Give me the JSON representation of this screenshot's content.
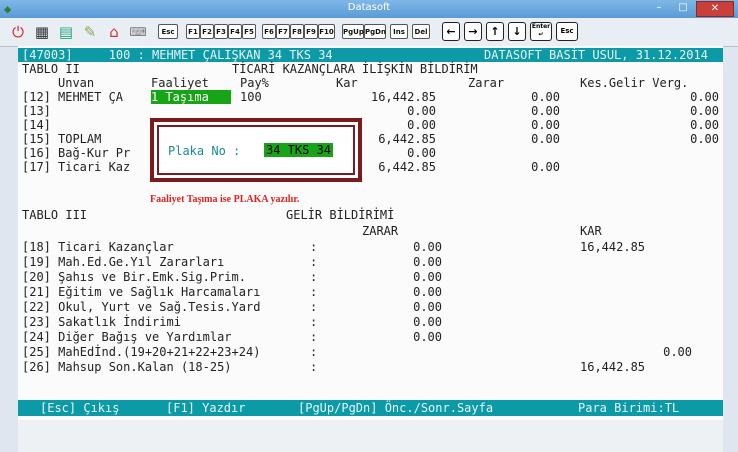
{
  "window": {
    "title": "Datasoft",
    "minimize": "–",
    "maximize": "□",
    "close": "✕"
  },
  "toolbar": {
    "keys": [
      "Esc",
      "F1",
      "F2",
      "F3",
      "F4",
      "F5",
      "F6",
      "F7",
      "F8",
      "F9",
      "F10",
      "PgUp",
      "PgDn",
      "Ins",
      "Del",
      "Enter",
      "Esc"
    ]
  },
  "header": {
    "left": "[47003]     100 : MEHMET ÇALIŞKAN 34 TKS 34",
    "right": "DATASOFT BASİT USUL, 31.12.2014"
  },
  "tablo2": {
    "name": "TABLO II",
    "title": "TİCARİ KAZANÇLARA İLİŞKİN BİLDİRİM",
    "cols": {
      "unvan": "Unvan",
      "faaliyet": "Faaliyet",
      "pay": "Pay%",
      "kar": "Kar",
      "zarar": "Zarar",
      "kes": "Kes.Gelir Verg."
    },
    "rows": [
      {
        "no": "[12]",
        "unvan": "MEHMET ÇA",
        "faaliyet": "1 Taşıma",
        "pay": "100",
        "kar": "16,442.85",
        "zarar": "0.00",
        "kes": "0.00"
      },
      {
        "no": "[13]",
        "unvan": "",
        "faaliyet": "",
        "pay": "",
        "kar": "0.00",
        "zarar": "0.00",
        "kes": "0.00"
      },
      {
        "no": "[14]",
        "unvan": "",
        "faaliyet": "",
        "pay": "",
        "kar": "0.00",
        "zarar": "0.00",
        "kes": "0.00"
      },
      {
        "no": "[15]",
        "unvan": "TOPLAM",
        "faaliyet": "",
        "pay": "",
        "kar": "6,442.85",
        "zarar": "0.00",
        "kes": "0.00"
      },
      {
        "no": "[16]",
        "unvan": "Bağ-Kur Pr",
        "faaliyet": "",
        "pay": "",
        "kar": "0.00",
        "zarar": "",
        "kes": ""
      },
      {
        "no": "[17]",
        "unvan": "Ticari Kaz",
        "faaliyet": "",
        "pay": "",
        "kar": "6,442.85",
        "zarar": "0.00",
        "kes": ""
      }
    ]
  },
  "dialog": {
    "label": "Plaka No :",
    "value": "34 TKS 34"
  },
  "hint": "Faaliyet Taşıma ise PLAKA yazılır.",
  "tablo3": {
    "name": "TABLO III",
    "title": "GELİR BİLDİRİMİ",
    "col_zarar": "ZARAR",
    "col_kar": "KAR",
    "rows": [
      {
        "text": "[18] Ticari Kazançlar",
        "colon": ":",
        "zarar": "0.00",
        "kar": "16,442.85"
      },
      {
        "text": "[19] Mah.Ed.Ge.Yıl Zararları",
        "colon": ":",
        "zarar": "0.00",
        "kar": ""
      },
      {
        "text": "[20] Şahıs ve Bir.Emk.Sig.Prim.",
        "colon": ":",
        "zarar": "0.00",
        "kar": ""
      },
      {
        "text": "[21] Eğitim ve Sağlık Harcamaları",
        "colon": ":",
        "zarar": "0.00",
        "kar": ""
      },
      {
        "text": "[22] Okul, Yurt ve Sağ.Tesis.Yard",
        "colon": ":",
        "zarar": "0.00",
        "kar": ""
      },
      {
        "text": "[23] Sakatlık İndirimi",
        "colon": ":",
        "zarar": "0.00",
        "kar": ""
      },
      {
        "text": "[24] Diğer Bağış ve Yardımlar",
        "colon": ":",
        "zarar": "0.00",
        "kar": ""
      },
      {
        "text": "[25] MahEdİnd.(19+20+21+22+23+24)",
        "colon": ":",
        "zarar": "",
        "kar": "0.00"
      },
      {
        "text": "[26] Mahsup Son.Kalan (18-25)",
        "colon": ":",
        "zarar": "",
        "kar": "16,442.85"
      }
    ]
  },
  "status": {
    "esc": "[Esc] Çıkış",
    "f1": "[F1] Yazdır",
    "pg": "[PgUp/PgDn] Önc./Sonr.Sayfa",
    "currency": "Para Birimi:TL"
  },
  "colors": {
    "accent": "#0b9aa6",
    "highlight": "#17a417",
    "dialog_border": "#7a1a1a",
    "hint": "#dd2222"
  }
}
